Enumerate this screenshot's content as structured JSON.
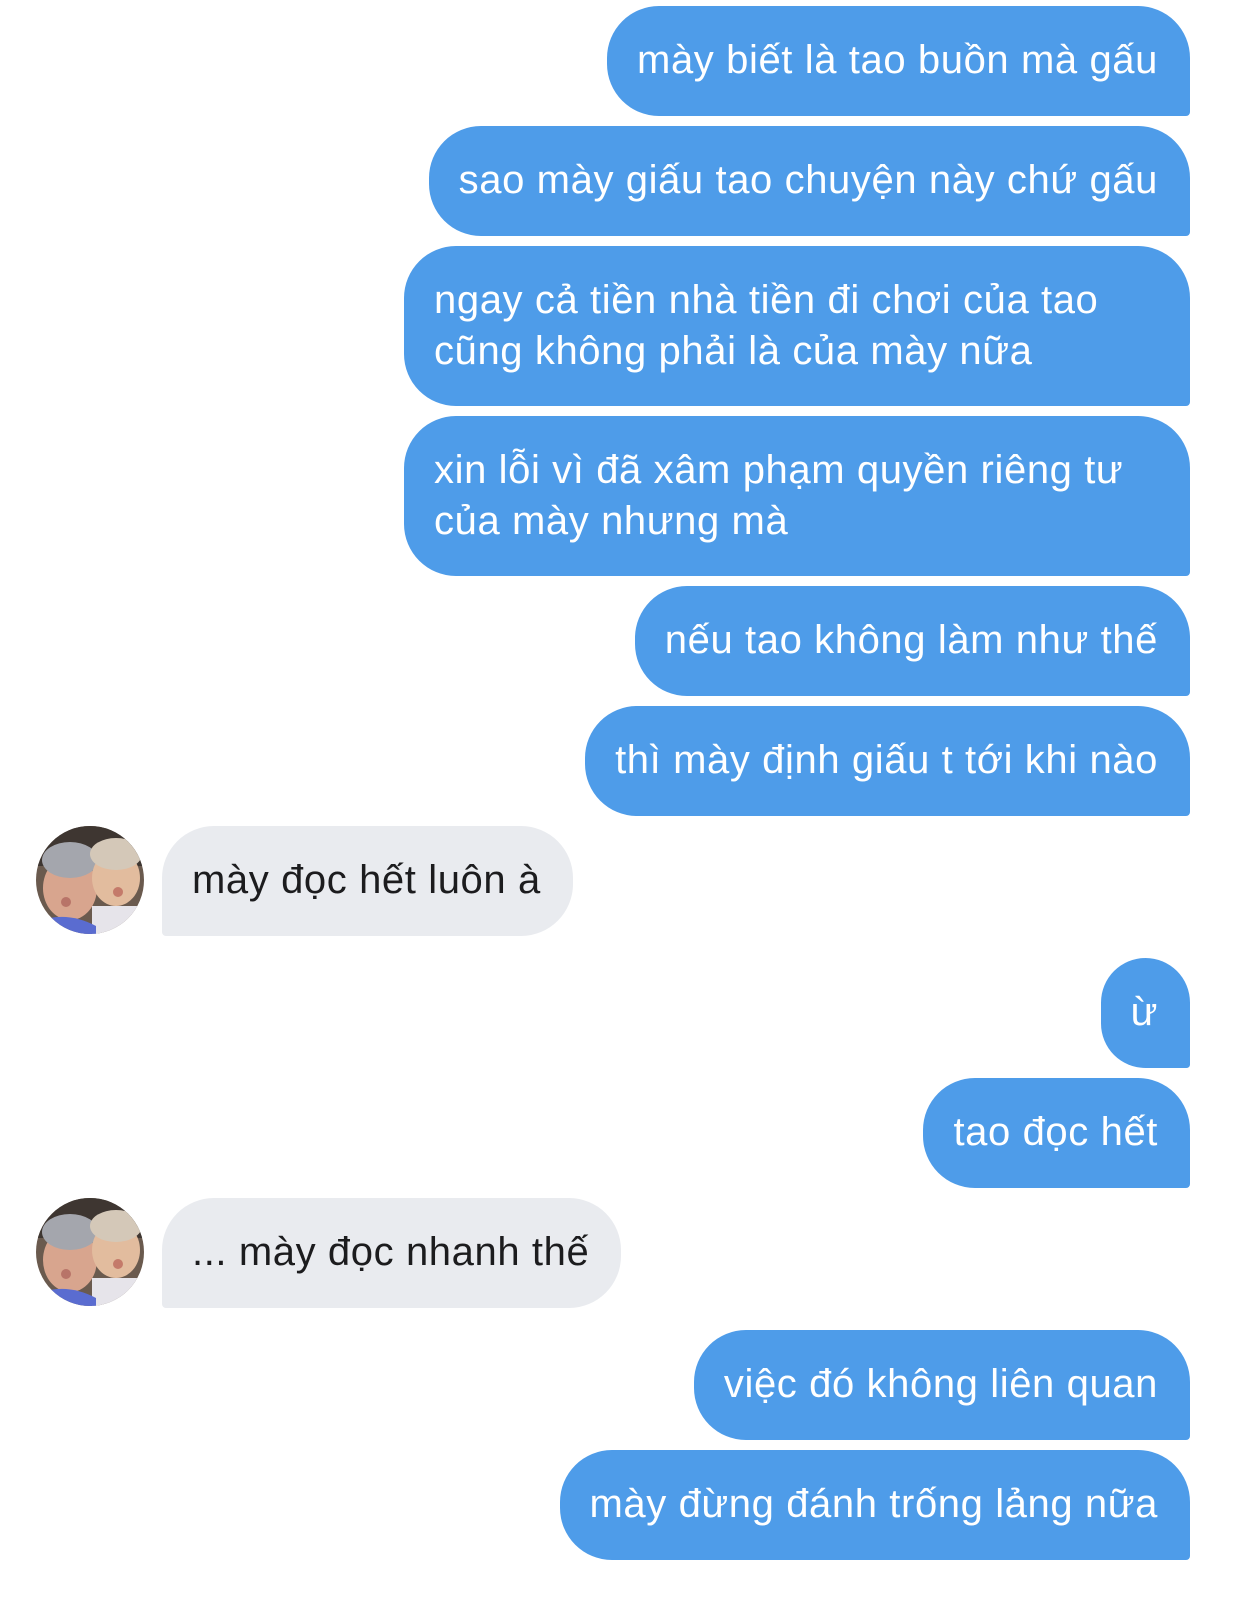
{
  "conversation": {
    "messages": [
      {
        "sender": "me",
        "text": "mày biết là tao buồn mà gấu"
      },
      {
        "sender": "me",
        "text": "sao mày giấu tao chuyện này chứ gấu"
      },
      {
        "sender": "me",
        "line1": "ngay cả tiền nhà tiền đi chơi của tao",
        "line2": "cũng không phải là của mày nữa"
      },
      {
        "sender": "me",
        "line1": "xin lỗi vì đã xâm phạm quyền riêng tư",
        "line2": "của mày nhưng mà"
      },
      {
        "sender": "me",
        "text": "nếu tao không làm như thế"
      },
      {
        "sender": "me",
        "text": "thì mày định giấu t tới khi nào"
      },
      {
        "sender": "them",
        "text": "mày đọc hết luôn à"
      },
      {
        "sender": "me",
        "text": "ừ"
      },
      {
        "sender": "me",
        "text": "tao đọc hết"
      },
      {
        "sender": "them",
        "text": "... mày đọc nhanh thế"
      },
      {
        "sender": "me",
        "text": "việc đó không liên quan"
      },
      {
        "sender": "me",
        "text": "mày đừng đánh trống lảng nữa"
      }
    ]
  },
  "colors": {
    "outgoing_bubble": "#4e9ce9",
    "incoming_bubble": "#e9ebef",
    "outgoing_text": "#ffffff",
    "incoming_text": "#1c1c1e"
  },
  "icons": {
    "avatar": "contact-photo"
  }
}
